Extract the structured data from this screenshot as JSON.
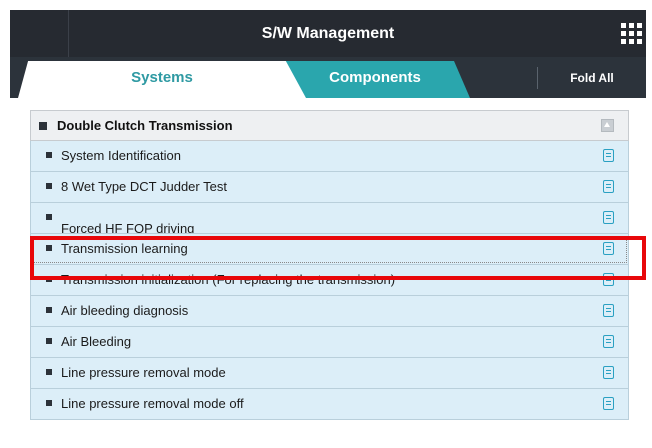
{
  "window": {
    "title": "S/W Management",
    "menu_icon": "grid-menu-icon"
  },
  "tabs": {
    "systems_label": "Systems",
    "components_label": "Components",
    "active": "Systems",
    "fold_all_label": "Fold All"
  },
  "group": {
    "label": "Double Clutch Transmission",
    "icon": "collapse-icon",
    "items": [
      {
        "label": "System Identification",
        "icon": "document-icon"
      },
      {
        "label": "8 Wet Type DCT Judder Test",
        "icon": "document-icon"
      },
      {
        "label": "Forced HF FOP driving",
        "icon": "document-icon"
      },
      {
        "label": "Transmission learning",
        "icon": "document-icon"
      },
      {
        "label": "Transmission initialization (For replacing the transmission)",
        "icon": "document-icon"
      },
      {
        "label": "Air bleeding diagnosis",
        "icon": "document-icon"
      },
      {
        "label": "Air Bleeding",
        "icon": "document-icon"
      },
      {
        "label": "Line pressure removal mode",
        "icon": "document-icon"
      },
      {
        "label": "Line pressure removal mode off",
        "icon": "document-icon"
      }
    ]
  },
  "highlighted_item": "Transmission learning",
  "colors": {
    "titlebar_bg": "#262a31",
    "tab_active_text": "#2f9aa3",
    "tab_inactive_bg": "#2aa6ad",
    "item_bg": "#dceef8",
    "highlight_border": "#e8070a",
    "doc_icon": "#2aa0c2"
  }
}
